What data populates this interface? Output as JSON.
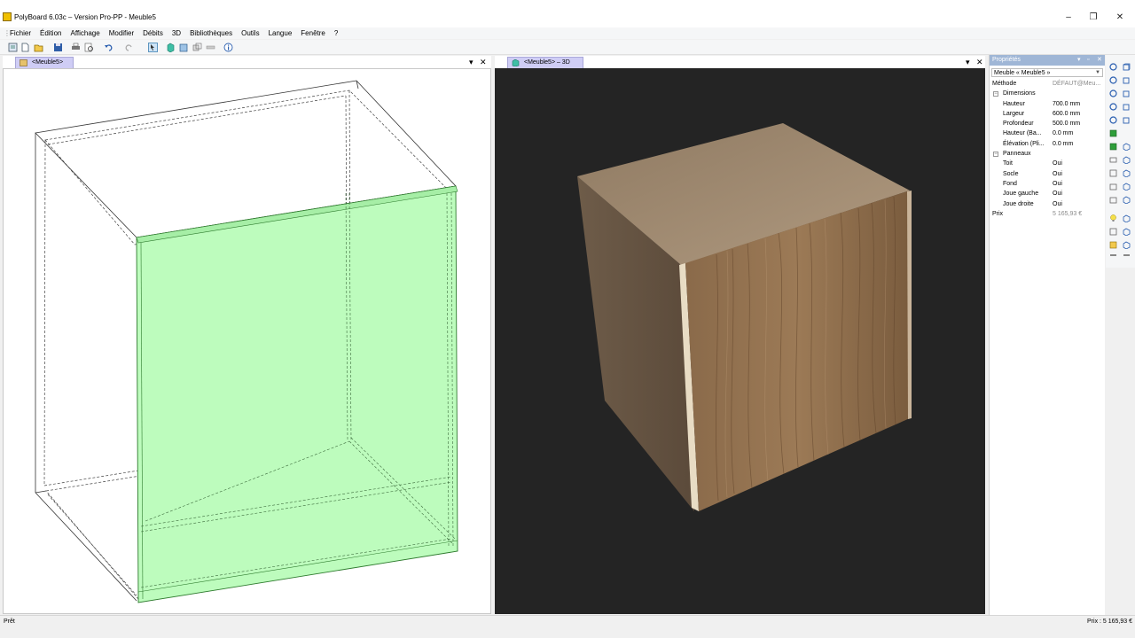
{
  "window": {
    "title": "PolyBoard 6.03c – Version Pro-PP - Meuble5",
    "minimize": "–",
    "maximize": "❐",
    "close": "✕"
  },
  "menu": [
    "Fichier",
    "Édition",
    "Affichage",
    "Modifier",
    "Débits",
    "3D",
    "Bibliothèques",
    "Outils",
    "Langue",
    "Fenêtre",
    "?"
  ],
  "toolbar": {
    "icons": [
      "new-project-icon",
      "new-file-icon",
      "open-folder-icon",
      "save-icon",
      "print-icon",
      "print-preview-icon",
      "undo-icon",
      "redo-icon",
      "select-icon",
      "view-3d-icon",
      "cabinet-icon",
      "duplicate-icon",
      "measure-icon",
      "info-icon"
    ]
  },
  "left_view": {
    "tab_label": "<Meuble5>",
    "dropdown": "▾",
    "close": "✕",
    "highlight_color": "#bdfcbd"
  },
  "right_view": {
    "tab_label": "<Meuble5> – 3D",
    "dropdown": "▾",
    "close": "✕",
    "background_color": "#242424"
  },
  "properties": {
    "header": "Propriétés",
    "header_controls": [
      "▾",
      "▫",
      "✕"
    ],
    "object_select": "Meuble « Meuble5 »",
    "methode": {
      "label": "Méthode",
      "value": "DÉFAUT@Meu..."
    },
    "dimensions": {
      "label": "Dimensions",
      "rows": [
        {
          "label": "Hauteur",
          "value": "700.0 mm"
        },
        {
          "label": "Largeur",
          "value": "600.0 mm"
        },
        {
          "label": "Profondeur",
          "value": "500.0 mm"
        },
        {
          "label": "Hauteur (Ba...",
          "value": "0.0 mm"
        },
        {
          "label": "Élévation (Pli...",
          "value": "0.0 mm"
        }
      ]
    },
    "panneaux": {
      "label": "Panneaux",
      "rows": [
        {
          "label": "Toit",
          "value": "Oui"
        },
        {
          "label": "Socle",
          "value": "Oui"
        },
        {
          "label": "Fond",
          "value": "Oui"
        },
        {
          "label": "Joue gauche",
          "value": "Oui"
        },
        {
          "label": "Joue droite",
          "value": "Oui"
        }
      ]
    },
    "prix": {
      "label": "Prix",
      "value": "5 165,93 €"
    }
  },
  "status": {
    "left": "Prêt",
    "right": "Prix : 5 165,93 €"
  }
}
